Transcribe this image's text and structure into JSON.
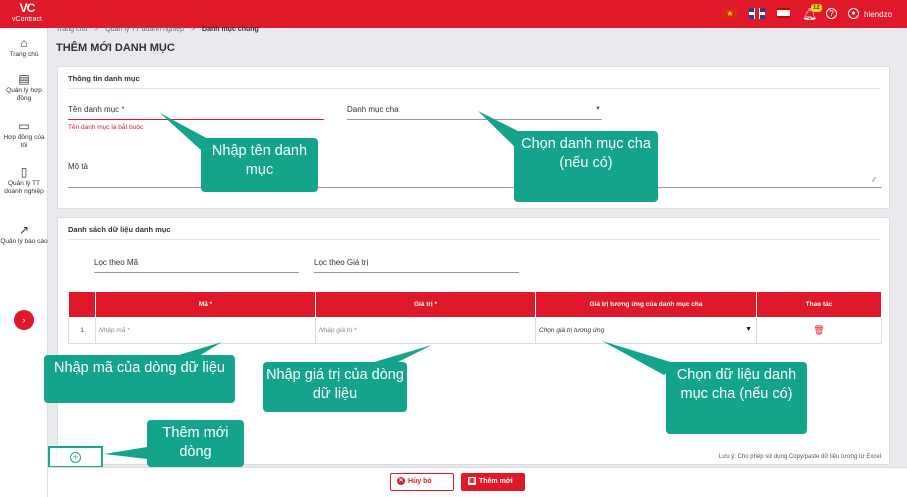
{
  "app": {
    "logo_mark": "VC",
    "logo_name": "vContract"
  },
  "topbar": {
    "flag_vn": "★",
    "notif_count": "12",
    "help": "?",
    "user_icon": "●",
    "username": "hiendzo"
  },
  "sidebar": {
    "items": [
      {
        "icon": "⌂",
        "label": "Trang chủ"
      },
      {
        "icon": "▤",
        "label": "Quản lý hợp đồng"
      },
      {
        "icon": "▭",
        "label": "Hợp đồng của tôi"
      },
      {
        "icon": "▯",
        "label": "Quản lý TT doanh nghiệp"
      },
      {
        "icon": "↗",
        "label": "Quản lý báo cáo"
      }
    ],
    "expand": "›"
  },
  "breadcrumb": {
    "items": [
      "Trang chủ",
      "Quản lý TT doanh nghiệp",
      "Danh mục chung"
    ],
    "sep": ">"
  },
  "page_title": "THÊM MỚI DANH MỤC",
  "info": {
    "title": "Thông tin danh mục",
    "name_label": "Tên danh mục",
    "required_mark": "*",
    "name_error": "Tên danh mục là bắt buộc",
    "parent_label": "Danh mục cha",
    "desc_label": "Mô tả"
  },
  "data_section": {
    "title": "Danh sách dữ liệu danh mục",
    "filter_code": "Lọc theo Mã",
    "filter_value": "Lọc theo Giá trị",
    "columns": [
      "",
      "Mã *",
      "Giá trị *",
      "Giá trị tương ứng của danh mục cha",
      "Thao tác"
    ],
    "rows": [
      {
        "index": "1",
        "code_placeholder": "Nhập mã *",
        "value_placeholder": "Nhập giá trị *",
        "parent_value": "Chọn giá trị tương ứng",
        "delete_icon": "🗑"
      }
    ],
    "add_row_icon": "+",
    "note": "Lưu ý: Cho phép sử dụng Copy/paste dữ liệu tương tự Excel"
  },
  "footer": {
    "cancel_label": "Hủy bỏ",
    "cancel_icon": "✕",
    "save_label": "Thêm mới",
    "save_icon": "▣"
  },
  "callouts": {
    "name": "Nhập tên danh mục",
    "parent": "Chọn danh mục cha (nếu có)",
    "code": "Nhập mã của dòng dữ liệu",
    "value": "Nhập giá trị của dòng dữ liệu",
    "parent_value": "Chọn dữ liệu danh mục cha (nếu có)",
    "add_row": "Thêm mới dòng"
  },
  "colors": {
    "brand_red": "#e0192a",
    "callout_teal": "#14a48c"
  }
}
